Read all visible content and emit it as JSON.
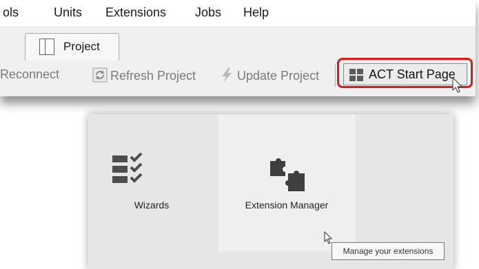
{
  "menu": {
    "items": [
      {
        "label": "ols",
        "key": "tools"
      },
      {
        "label": "Units",
        "key": "units"
      },
      {
        "label": "Extensions",
        "key": "extensions"
      },
      {
        "label": "Jobs",
        "key": "jobs"
      },
      {
        "label": "Help",
        "key": "help"
      }
    ]
  },
  "tabs": [
    {
      "label": "Project",
      "icon": "project-layout-icon",
      "active": true
    }
  ],
  "toolbar": {
    "reconnect_label": "Reconnect",
    "refresh_label": "Refresh Project",
    "update_label": "Update Project",
    "start_page_label": "ACT Start Page"
  },
  "start_page": {
    "cards": [
      {
        "label": "Wizards",
        "icon": "wizards-checklist-icon"
      },
      {
        "label": "Extension Manager",
        "icon": "puzzle-pieces-icon"
      }
    ],
    "tooltip": "Manage your extensions"
  },
  "colors": {
    "highlight": "#e01818",
    "toolbar_bg": "#f0f0f0",
    "panel_bg": "#e6e6e6"
  }
}
